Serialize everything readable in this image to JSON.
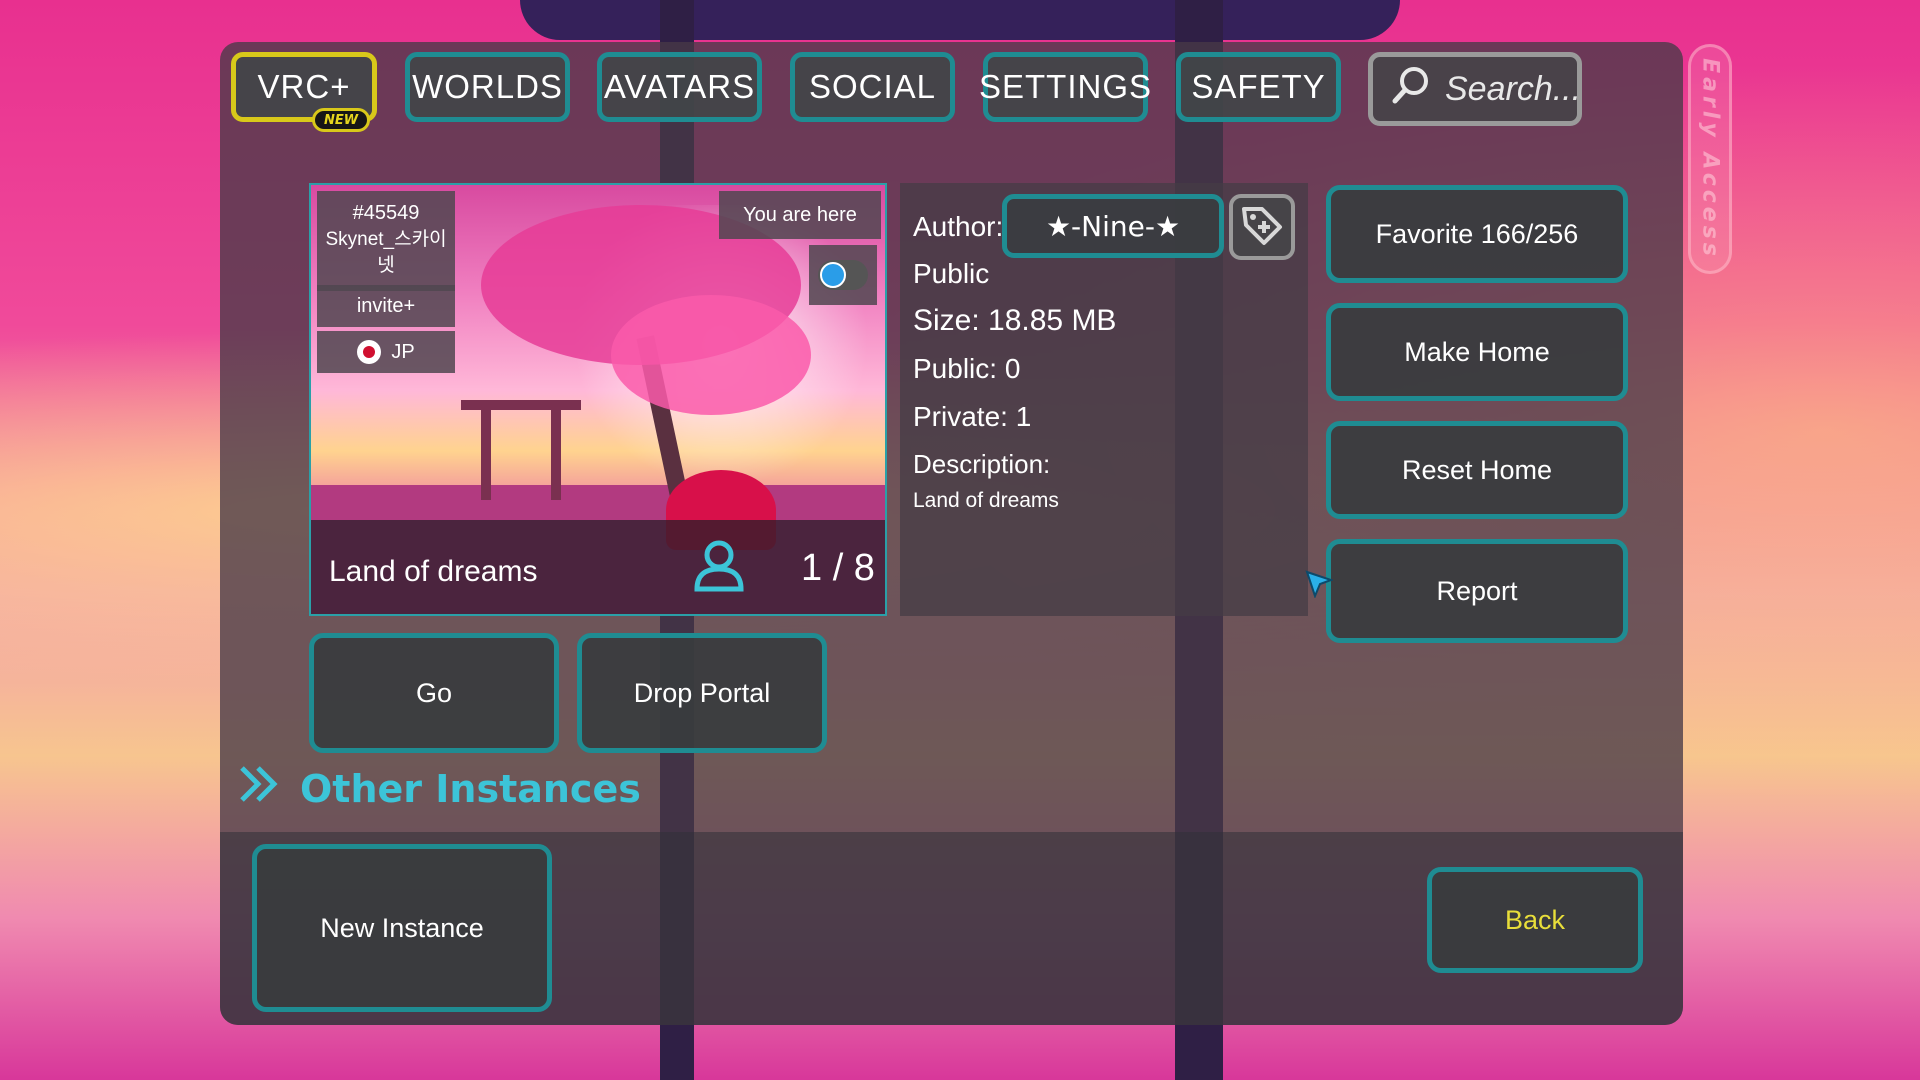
{
  "nav": {
    "vrc_plus": "VRC+",
    "new_badge": "NEW",
    "worlds": "WORLDS",
    "avatars": "AVATARS",
    "social": "SOCIAL",
    "settings": "SETTINGS",
    "safety": "SAFETY",
    "search_placeholder": "Search..."
  },
  "early_access": "Early Access",
  "instance": {
    "id": "#45549",
    "owner": "Skynet_스카이넷",
    "type": "invite+",
    "region": "JP",
    "you_are_here": "You are here",
    "world_name": "Land of dreams",
    "players": "1 / 8"
  },
  "details": {
    "author_label": "Author:",
    "author_name": "★-Nine-★",
    "visibility": "Public",
    "size": "Size: 18.85 MB",
    "public_count": "Public: 0",
    "private_count": "Private: 1",
    "description_label": "Description:",
    "description": "Land of dreams"
  },
  "actions": {
    "favorite": "Favorite 166/256",
    "make_home": "Make Home",
    "reset_home": "Reset Home",
    "report": "Report",
    "go": "Go",
    "drop_portal": "Drop Portal",
    "new_instance": "New Instance",
    "back": "Back"
  },
  "section": {
    "other_instances": "Other Instances"
  },
  "colors": {
    "accent_teal": "#1f8c92",
    "vrc_yellow": "#d8c81a",
    "section_cyan": "#3cc4d8",
    "back_text": "#e8de3a"
  },
  "icons": [
    "search-icon",
    "add-tag-icon",
    "user-icon",
    "chevron-double-right-icon",
    "japan-flag-icon",
    "platform-toggle-icon",
    "cursor-icon"
  ]
}
